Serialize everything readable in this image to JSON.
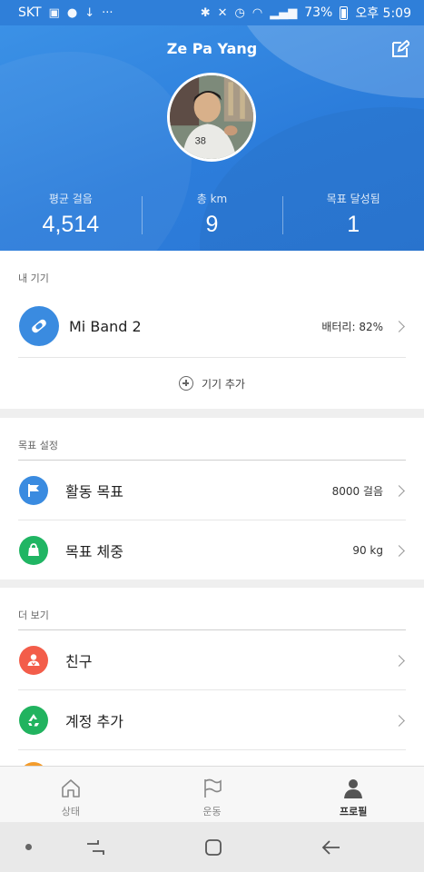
{
  "status_bar": {
    "carrier": "SKT",
    "battery": "73%",
    "time": "오후 5:09",
    "overflow": "···"
  },
  "profile": {
    "name": "Ze Pa Yang",
    "edit_icon": "edit-icon",
    "avatar": "user-avatar-photo"
  },
  "stats": [
    {
      "label": "평균 걸음",
      "value": "4,514"
    },
    {
      "label": "총 km",
      "value": "9"
    },
    {
      "label": "목표 달성됨",
      "value": "1"
    }
  ],
  "my_devices": {
    "title": "내 기기",
    "device": {
      "name": "Mi Band 2",
      "status": "배터리: 82%",
      "icon": "band-icon"
    },
    "add_label": "기기 추가"
  },
  "goals": {
    "title": "목표 설정",
    "items": [
      {
        "label": "활동 목표",
        "value": "8000 걸음",
        "icon": "flag-icon",
        "color": "#3a8be0"
      },
      {
        "label": "목표 체중",
        "value": "90 kg",
        "icon": "weight-icon",
        "color": "#20b563"
      }
    ]
  },
  "more": {
    "title": "더 보기",
    "items": [
      {
        "label": "친구",
        "icon": "friends-icon",
        "color": "#f35d4a"
      },
      {
        "label": "계정 추가",
        "icon": "recycle-icon",
        "color": "#21b35f"
      }
    ]
  },
  "tabs": [
    {
      "label": "상태",
      "icon": "home-icon",
      "active": false
    },
    {
      "label": "운동",
      "icon": "flag-outline-icon",
      "active": false
    },
    {
      "label": "프로필",
      "icon": "person-icon",
      "active": true
    }
  ],
  "colors": {
    "header": "#2f7fd9",
    "accent_blue": "#3a8be0",
    "accent_green": "#20b563",
    "accent_red": "#f35d4a"
  }
}
